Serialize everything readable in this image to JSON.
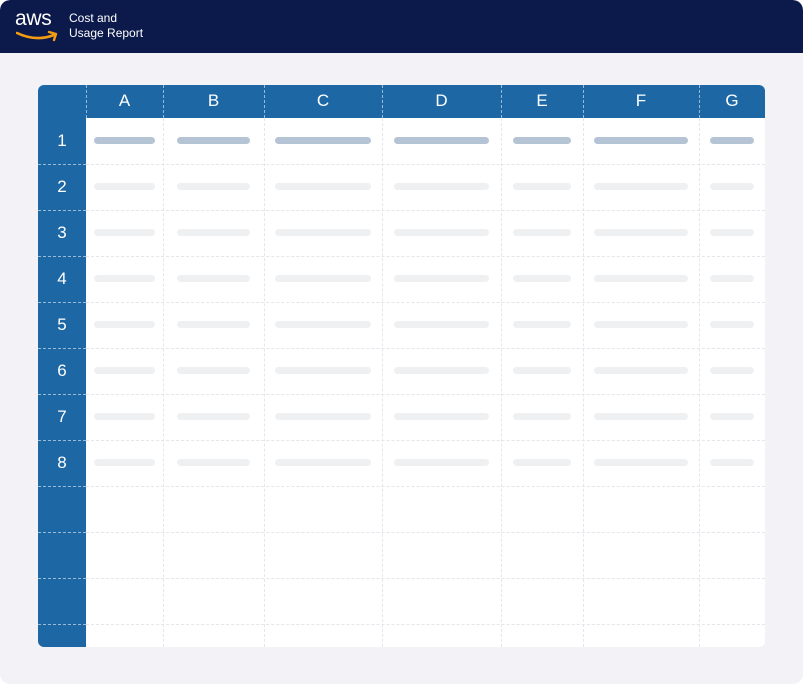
{
  "app": {
    "logo_text": "aws",
    "title_line1": "Cost and",
    "title_line2": "Usage Report"
  },
  "sheet": {
    "columns": [
      "A",
      "B",
      "C",
      "D",
      "E",
      "F",
      "G"
    ],
    "rows": [
      "1",
      "2",
      "3",
      "4",
      "5",
      "6",
      "7",
      "8",
      "",
      "",
      ""
    ],
    "filled_rows": 8,
    "header_row_index": 0
  },
  "colors": {
    "topbar": "#0c1a4b",
    "background": "#f3f2f7",
    "header_blue": "#1e67a5",
    "logo_smile": "#f39c12",
    "placeholder_header": "#b5c4d4",
    "placeholder_cell": "#eef0f2"
  },
  "icons": {
    "logo": "aws-logo-icon"
  }
}
